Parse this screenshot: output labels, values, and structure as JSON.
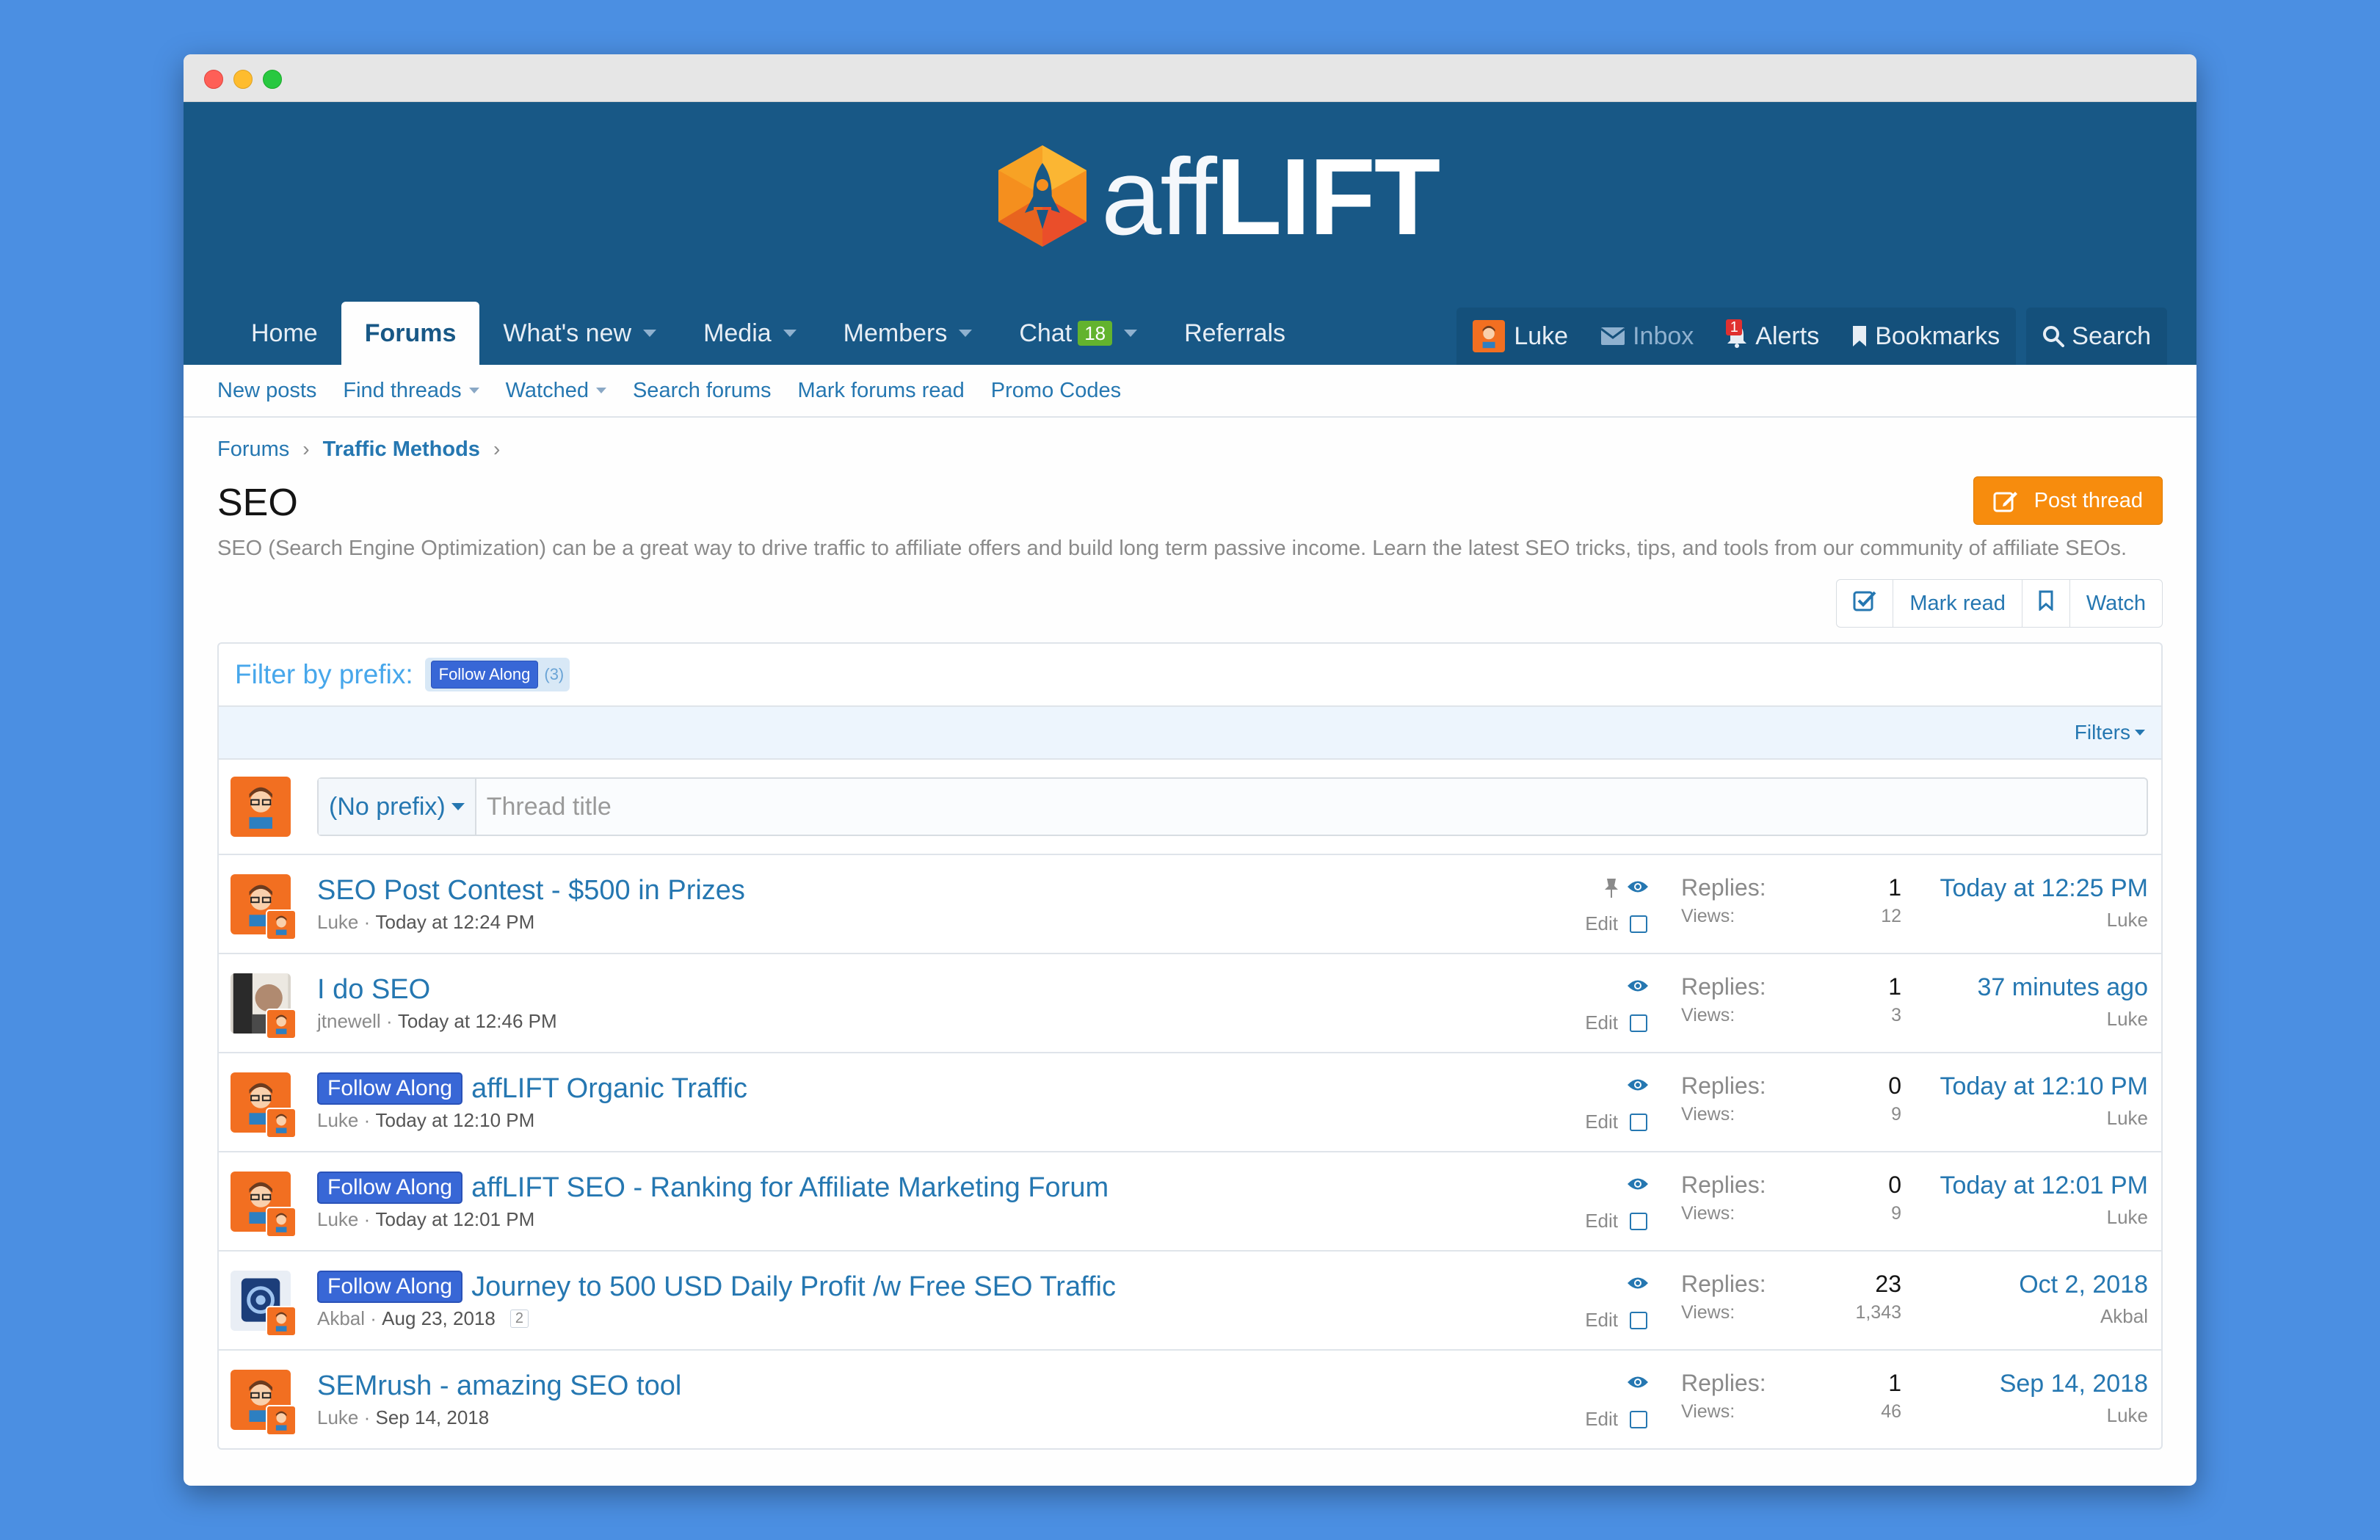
{
  "header": {
    "logo_light": "aff",
    "logo_bold": "LIFT"
  },
  "nav": {
    "tabs": [
      {
        "label": "Home"
      },
      {
        "label": "Forums"
      },
      {
        "label": "What's new"
      },
      {
        "label": "Media"
      },
      {
        "label": "Members"
      },
      {
        "label": "Chat",
        "badge": "18"
      },
      {
        "label": "Referrals"
      }
    ],
    "user": "Luke",
    "inbox": "Inbox",
    "alerts": "Alerts",
    "alerts_badge": "1",
    "bookmarks": "Bookmarks",
    "search": "Search"
  },
  "subnav": {
    "items": [
      "New posts",
      "Find threads",
      "Watched",
      "Search forums",
      "Mark forums read",
      "Promo Codes"
    ]
  },
  "breadcrumb": [
    "Forums",
    "Traffic Methods"
  ],
  "page": {
    "title": "SEO",
    "post_thread": "Post thread",
    "description": "SEO (Search Engine Optimization) can be a great way to drive traffic to affiliate offers and build long term passive income. Learn the latest SEO tricks, tips, and tools from our community of affiliate SEOs.",
    "mark_read": "Mark read",
    "watch": "Watch"
  },
  "filter": {
    "label": "Filter by prefix:",
    "prefix": "Follow Along",
    "count": "(3)",
    "filters": "Filters"
  },
  "quick": {
    "prefix": "(No prefix)",
    "placeholder": "Thread title"
  },
  "labels": {
    "replies": "Replies:",
    "views": "Views:",
    "edit": "Edit"
  },
  "threads": [
    {
      "prefix": "",
      "title": "SEO Post Contest - $500 in Prizes",
      "author": "Luke",
      "date": "Today at 12:24 PM",
      "replies": "1",
      "views": "12",
      "last_date": "Today at 12:25 PM",
      "last_user": "Luke"
    },
    {
      "prefix": "",
      "title": "I do SEO",
      "author": "jtnewell",
      "date": "Today at 12:46 PM",
      "replies": "1",
      "views": "3",
      "last_date": "37 minutes ago",
      "last_user": "Luke"
    },
    {
      "prefix": "Follow Along",
      "title": "affLIFT Organic Traffic",
      "author": "Luke",
      "date": "Today at 12:10 PM",
      "replies": "0",
      "views": "9",
      "last_date": "Today at 12:10 PM",
      "last_user": "Luke"
    },
    {
      "prefix": "Follow Along",
      "title": "affLIFT SEO - Ranking for Affiliate Marketing Forum",
      "author": "Luke",
      "date": "Today at 12:01 PM",
      "replies": "0",
      "views": "9",
      "last_date": "Today at 12:01 PM",
      "last_user": "Luke"
    },
    {
      "prefix": "Follow Along",
      "title": "Journey to 500 USD Daily Profit /w Free SEO Traffic",
      "author": "Akbal",
      "date": "Aug 23, 2018",
      "page": "2",
      "replies": "23",
      "views": "1,343",
      "last_date": "Oct 2, 2018",
      "last_user": "Akbal"
    },
    {
      "prefix": "",
      "title": "SEMrush - amazing SEO tool",
      "author": "Luke",
      "date": "Sep 14, 2018",
      "replies": "1",
      "views": "46",
      "last_date": "Sep 14, 2018",
      "last_user": "Luke"
    }
  ],
  "colors": {
    "header": "#185886",
    "link": "#2577b1",
    "accent": "#f78c0d",
    "prefix": "#3867d6"
  }
}
